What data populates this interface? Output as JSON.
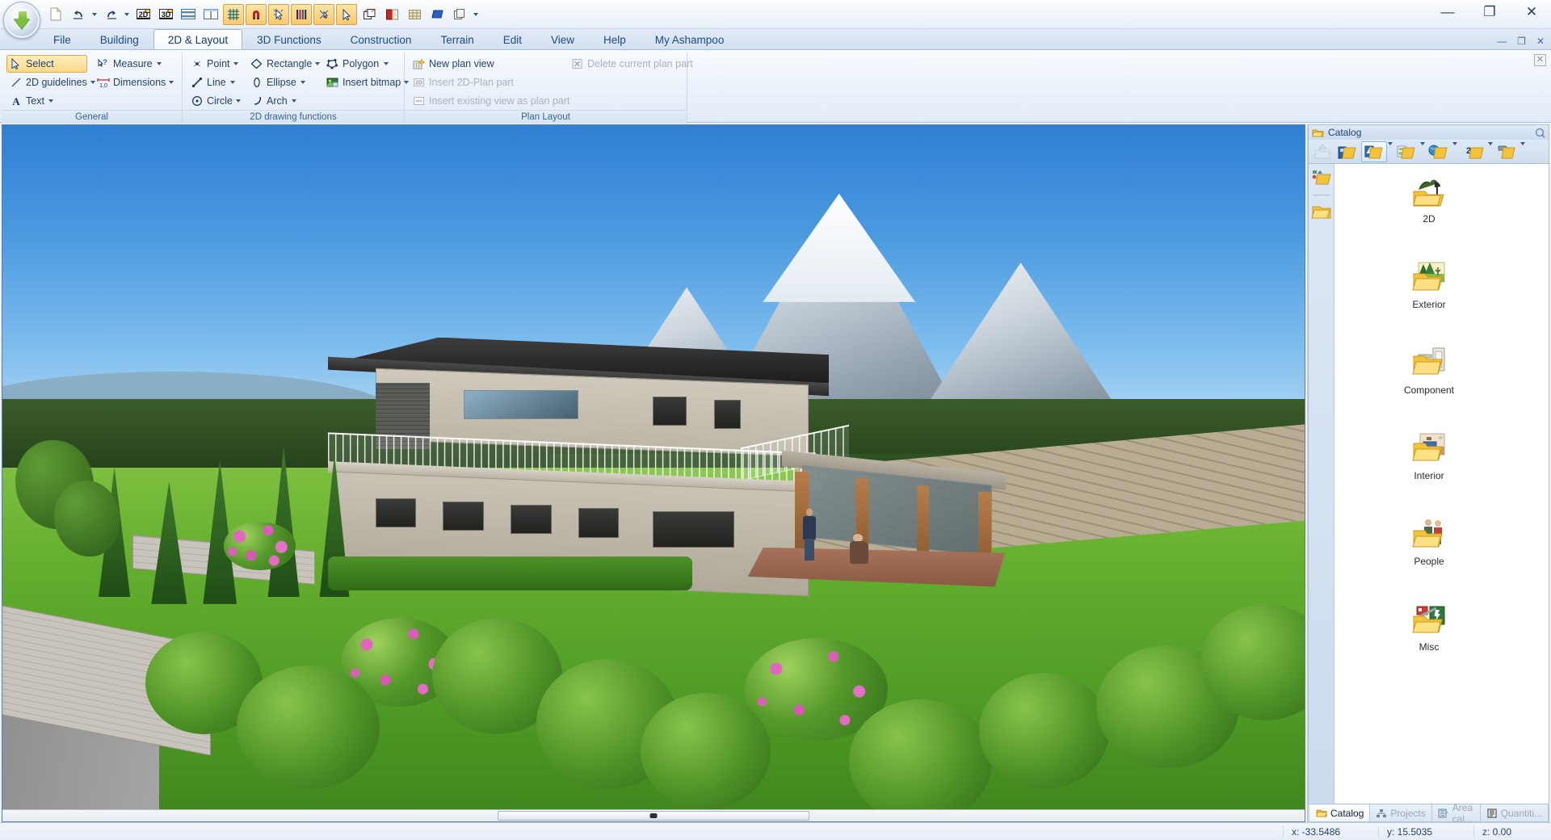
{
  "app": {
    "window_controls": {
      "minimize": "—",
      "maximize": "❐",
      "close": "✕"
    },
    "inner_window_controls": {
      "minimize": "—",
      "maximize": "❐",
      "close": "✕"
    }
  },
  "quick_access": {
    "items": [
      {
        "name": "new-document",
        "icon": "page-icon",
        "state": "normal"
      },
      {
        "name": "undo",
        "icon": "undo-arrow-icon",
        "state": "normal",
        "has_dropdown": true
      },
      {
        "name": "redo",
        "icon": "redo-arrow-icon",
        "state": "normal",
        "has_dropdown": true
      },
      {
        "name": "view-2d",
        "icon": "2d-view-icon",
        "label": "2D",
        "state": "normal"
      },
      {
        "name": "view-3d",
        "icon": "3d-view-icon",
        "label": "3D",
        "state": "normal"
      },
      {
        "name": "split-horizontal",
        "icon": "split-horizontal-icon",
        "state": "normal"
      },
      {
        "name": "split-vertical",
        "icon": "split-vertical-icon",
        "state": "normal"
      },
      {
        "name": "grid-snap",
        "icon": "grid-icon",
        "state": "active"
      },
      {
        "name": "magnet-snap",
        "icon": "magnet-icon",
        "state": "active"
      },
      {
        "name": "object-snap",
        "icon": "object-snap-icon",
        "state": "active"
      },
      {
        "name": "wall-snap",
        "icon": "wall-snap-icon",
        "state": "active"
      },
      {
        "name": "point-snap",
        "icon": "point-snap-icon",
        "state": "active"
      },
      {
        "name": "select-pointer",
        "icon": "cursor-arrow-icon",
        "state": "active"
      },
      {
        "name": "copy-object",
        "icon": "copy-object-icon",
        "state": "normal"
      },
      {
        "name": "paint-surface",
        "icon": "paint-surface-icon",
        "state": "normal"
      },
      {
        "name": "texture-tool",
        "icon": "texture-icon",
        "state": "normal"
      },
      {
        "name": "material-tool",
        "icon": "material-icon",
        "state": "normal"
      },
      {
        "name": "layers-tool",
        "icon": "layers-icon",
        "state": "normal",
        "has_dropdown": true
      }
    ]
  },
  "menu_tabs": [
    {
      "label": "File",
      "active": false
    },
    {
      "label": "Building",
      "active": false
    },
    {
      "label": "2D & Layout",
      "active": true
    },
    {
      "label": "3D Functions",
      "active": false
    },
    {
      "label": "Construction",
      "active": false
    },
    {
      "label": "Terrain",
      "active": false
    },
    {
      "label": "Edit",
      "active": false
    },
    {
      "label": "View",
      "active": false
    },
    {
      "label": "Help",
      "active": false
    },
    {
      "label": "My Ashampoo",
      "active": false
    }
  ],
  "ribbon": {
    "close_label": "✕",
    "groups": [
      {
        "name": "general",
        "label": "General",
        "columns": [
          {
            "items": [
              {
                "label": "Select",
                "icon": "cursor-select-icon",
                "selected": true,
                "dropdown": false,
                "disabled": false
              },
              {
                "label": "2D guidelines",
                "icon": "diagonal-line-icon",
                "selected": false,
                "dropdown": true,
                "disabled": false
              },
              {
                "label": "Text",
                "icon": "text-a-icon",
                "selected": false,
                "dropdown": true,
                "disabled": false
              }
            ]
          },
          {
            "items": [
              {
                "label": "Measure",
                "icon": "measure-icon",
                "selected": false,
                "dropdown": true,
                "disabled": false
              },
              {
                "label": "Dimensions",
                "icon": "dimension-icon",
                "selected": false,
                "dropdown": true,
                "disabled": false
              }
            ]
          }
        ]
      },
      {
        "name": "2d-drawing-functions",
        "label": "2D drawing functions",
        "columns": [
          {
            "items": [
              {
                "label": "Point",
                "icon": "point-icon",
                "selected": false,
                "dropdown": true,
                "disabled": false
              },
              {
                "label": "Line",
                "icon": "line-icon",
                "selected": false,
                "dropdown": true,
                "disabled": false
              },
              {
                "label": "Circle",
                "icon": "circle-icon",
                "selected": false,
                "dropdown": true,
                "disabled": false
              }
            ]
          },
          {
            "items": [
              {
                "label": "Rectangle",
                "icon": "rectangle-icon",
                "selected": false,
                "dropdown": true,
                "disabled": false
              },
              {
                "label": "Ellipse",
                "icon": "ellipse-icon",
                "selected": false,
                "dropdown": true,
                "disabled": false
              },
              {
                "label": "Arch",
                "icon": "arch-icon",
                "selected": false,
                "dropdown": true,
                "disabled": false
              }
            ]
          },
          {
            "items": [
              {
                "label": "Polygon",
                "icon": "polygon-icon",
                "selected": false,
                "dropdown": true,
                "disabled": false
              },
              {
                "label": "Insert bitmap",
                "icon": "bitmap-icon",
                "selected": false,
                "dropdown": true,
                "disabled": false
              }
            ]
          }
        ]
      },
      {
        "name": "plan-layout",
        "label": "Plan Layout",
        "columns": [
          {
            "items": [
              {
                "label": "New plan view",
                "icon": "new-plan-view-icon",
                "selected": false,
                "dropdown": false,
                "disabled": false
              },
              {
                "label": "Insert 2D-Plan part",
                "icon": "2d-plan-part-icon",
                "selected": false,
                "dropdown": false,
                "disabled": true
              },
              {
                "label": "Insert existing view as plan part",
                "icon": "existing-view-icon",
                "selected": false,
                "dropdown": false,
                "disabled": true
              }
            ]
          },
          {
            "items": [
              {
                "label": "Delete current plan part",
                "icon": "delete-x-icon",
                "selected": false,
                "dropdown": false,
                "disabled": true
              }
            ]
          }
        ]
      }
    ]
  },
  "catalog": {
    "title": "Catalog",
    "restore_icon": "restore-panel-icon",
    "toolbar": [
      {
        "name": "up-level-button",
        "icon": "up-arrow-folder-icon",
        "active": false,
        "disabled": true,
        "dropdown": false
      },
      {
        "name": "building-catalog-button",
        "icon": "building-folder-icon",
        "active": false,
        "disabled": false,
        "dropdown": false
      },
      {
        "name": "objects-catalog-button",
        "icon": "objects-folder-icon",
        "active": true,
        "disabled": false,
        "dropdown": true
      },
      {
        "name": "textures-catalog-button",
        "icon": "textures-folder-icon",
        "active": false,
        "disabled": false,
        "dropdown": true
      },
      {
        "name": "materials-catalog-button",
        "icon": "materials-folder-icon",
        "active": false,
        "disabled": false,
        "dropdown": true
      },
      {
        "name": "2d-catalog-button",
        "icon": "2d-folder-icon",
        "label": "2D",
        "active": false,
        "disabled": false,
        "dropdown": true
      },
      {
        "name": "import-catalog-button",
        "icon": "import-folder-icon",
        "active": false,
        "disabled": false,
        "dropdown": true
      }
    ],
    "rail": [
      {
        "name": "rail-favorites",
        "icon": "shapes-folder-icon"
      },
      {
        "name": "rail-recent",
        "icon": "plain-folder-icon"
      }
    ],
    "items": [
      {
        "label": "2D",
        "icon": "2d-objects-folder-icon"
      },
      {
        "label": "Exterior",
        "icon": "exterior-folder-icon"
      },
      {
        "label": "Component",
        "icon": "component-folder-icon"
      },
      {
        "label": "Interior",
        "icon": "interior-folder-icon"
      },
      {
        "label": "People",
        "icon": "people-folder-icon"
      },
      {
        "label": "Misc",
        "icon": "misc-folder-icon"
      }
    ],
    "tabs": [
      {
        "label": "Catalog",
        "icon": "catalog-icon",
        "active": true
      },
      {
        "label": "Projects",
        "icon": "projects-icon",
        "active": false
      },
      {
        "label": "Area cal...",
        "icon": "area-calc-icon",
        "active": false
      },
      {
        "label": "Quantiti...",
        "icon": "quantities-icon",
        "active": false
      }
    ]
  },
  "status_bar": {
    "x": "x: -33.5486",
    "y": "y: 15.5035",
    "z": "z: 0.00"
  },
  "viewport": {
    "name": "3d-perspective-render",
    "description": "3D rendered view of a modern two-storey house with balcony railing, wooden pergola, flowering bushes, conifers, stone retaining walls, green lawn, forested hills and a snow-capped mountain range under a clear blue sky."
  }
}
